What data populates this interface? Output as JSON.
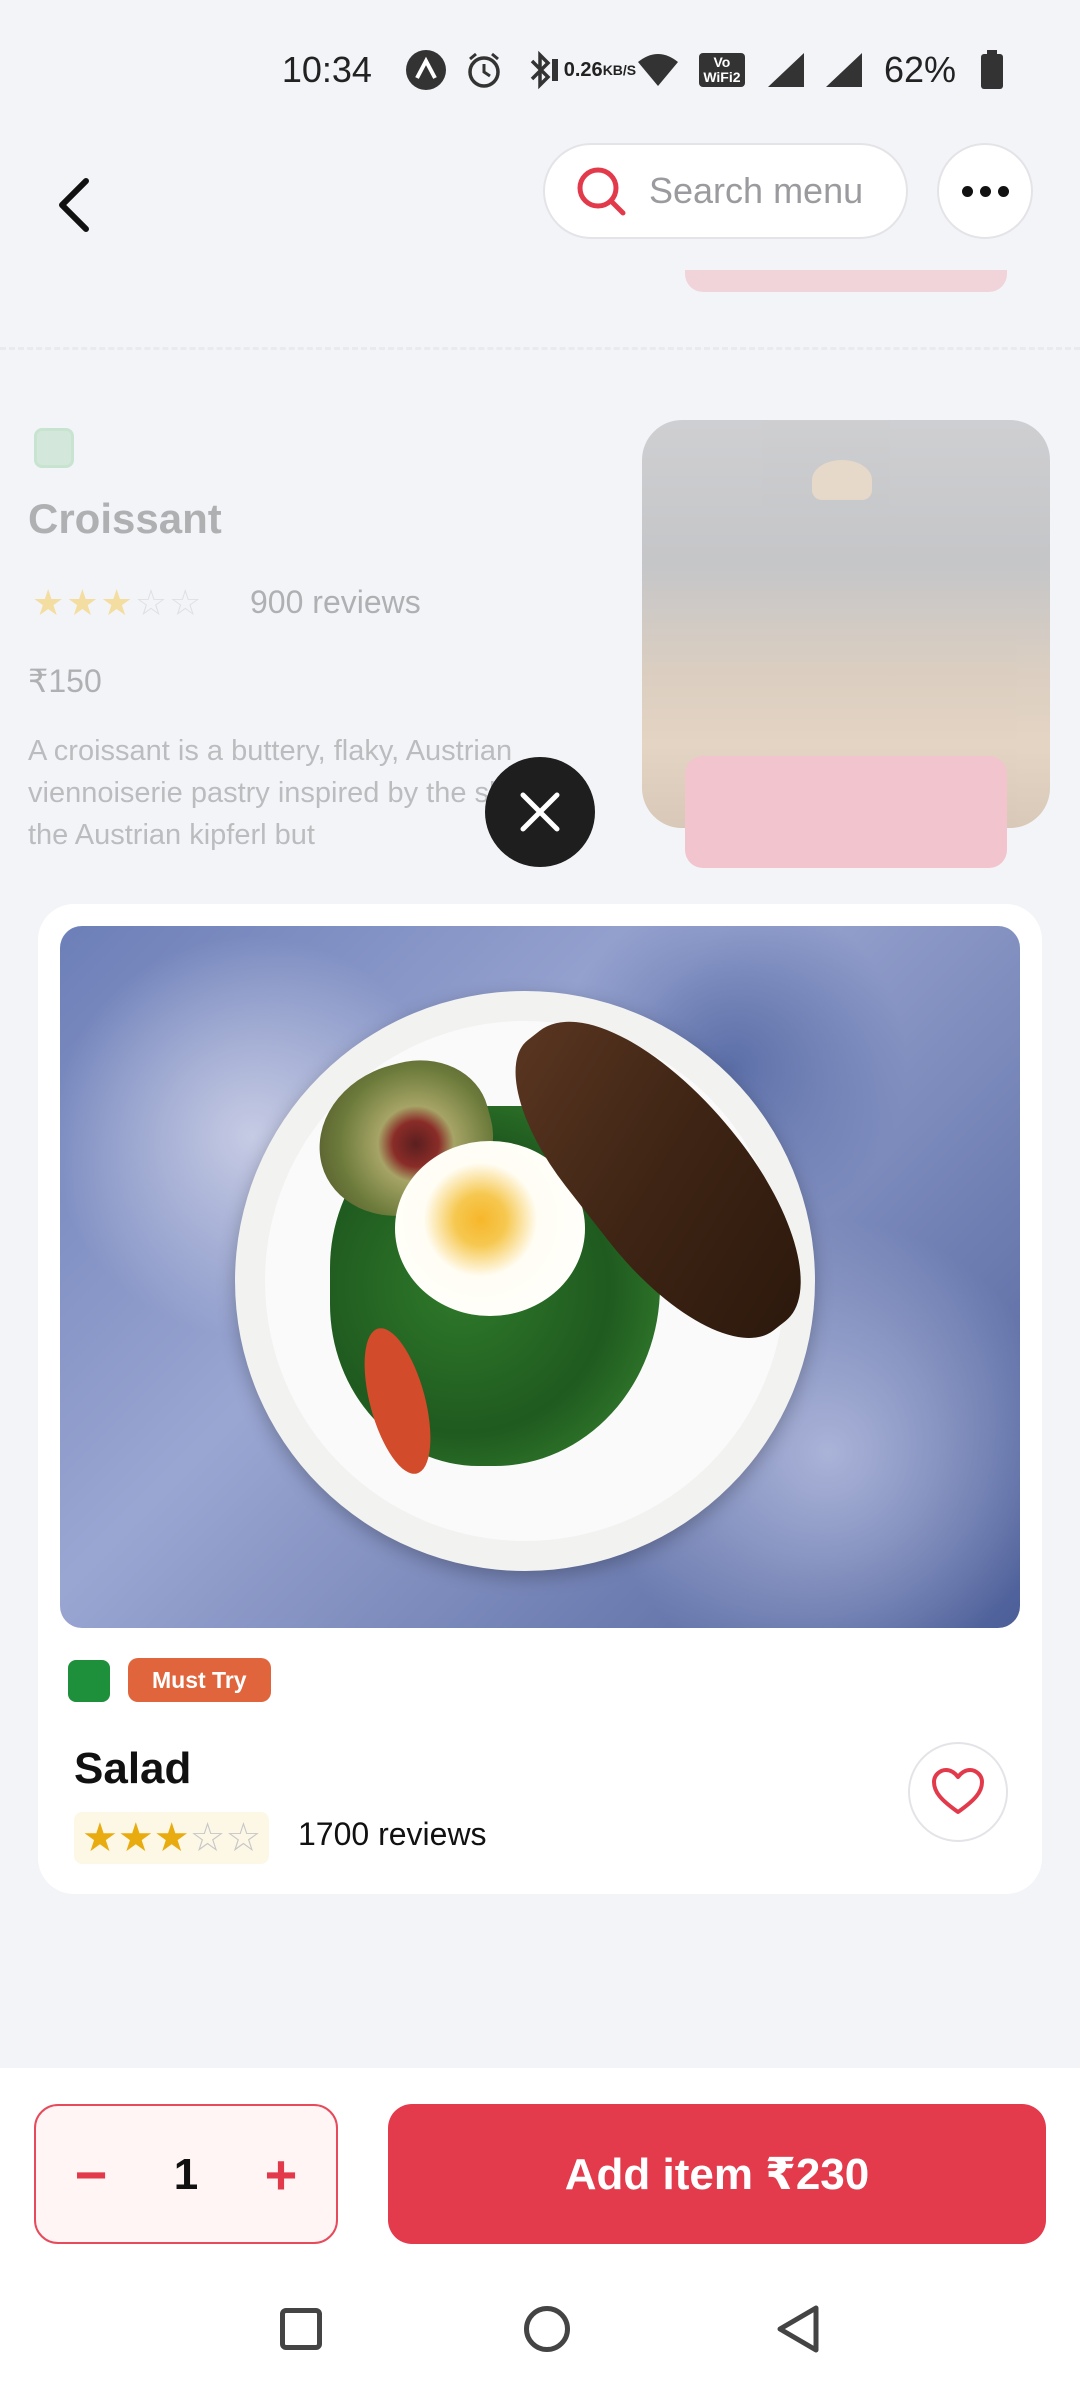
{
  "status_bar": {
    "time": "10:34",
    "network_speed_top": "0.26",
    "network_speed_unit": "KB/S",
    "volte_top": "Vo",
    "volte_bottom": "WiFi2",
    "battery_percent": "62%"
  },
  "header": {
    "search_placeholder": "Search menu",
    "back_icon": "chevron-left-icon",
    "search_icon": "search-icon",
    "more_icon": "more-horizontal-icon"
  },
  "background_item": {
    "name": "Croissant",
    "rating_stars_filled": 3,
    "reviews": "900 reviews",
    "price": "₹150",
    "description": "A croissant is a buttery, flaky, Austrian viennoiserie pastry inspired by the shape of the Austrian kipferl but"
  },
  "detail": {
    "badge": "Must Try",
    "name": "Salad",
    "rating_stars_filled": 3,
    "rating_stars_total": 5,
    "reviews": "1700 reviews",
    "veg_color": "#1e8f3b",
    "accent_color": "#e33a4c"
  },
  "cart": {
    "quantity": "1",
    "minus_label": "−",
    "plus_label": "+",
    "add_button_label": "Add item ₹230"
  }
}
